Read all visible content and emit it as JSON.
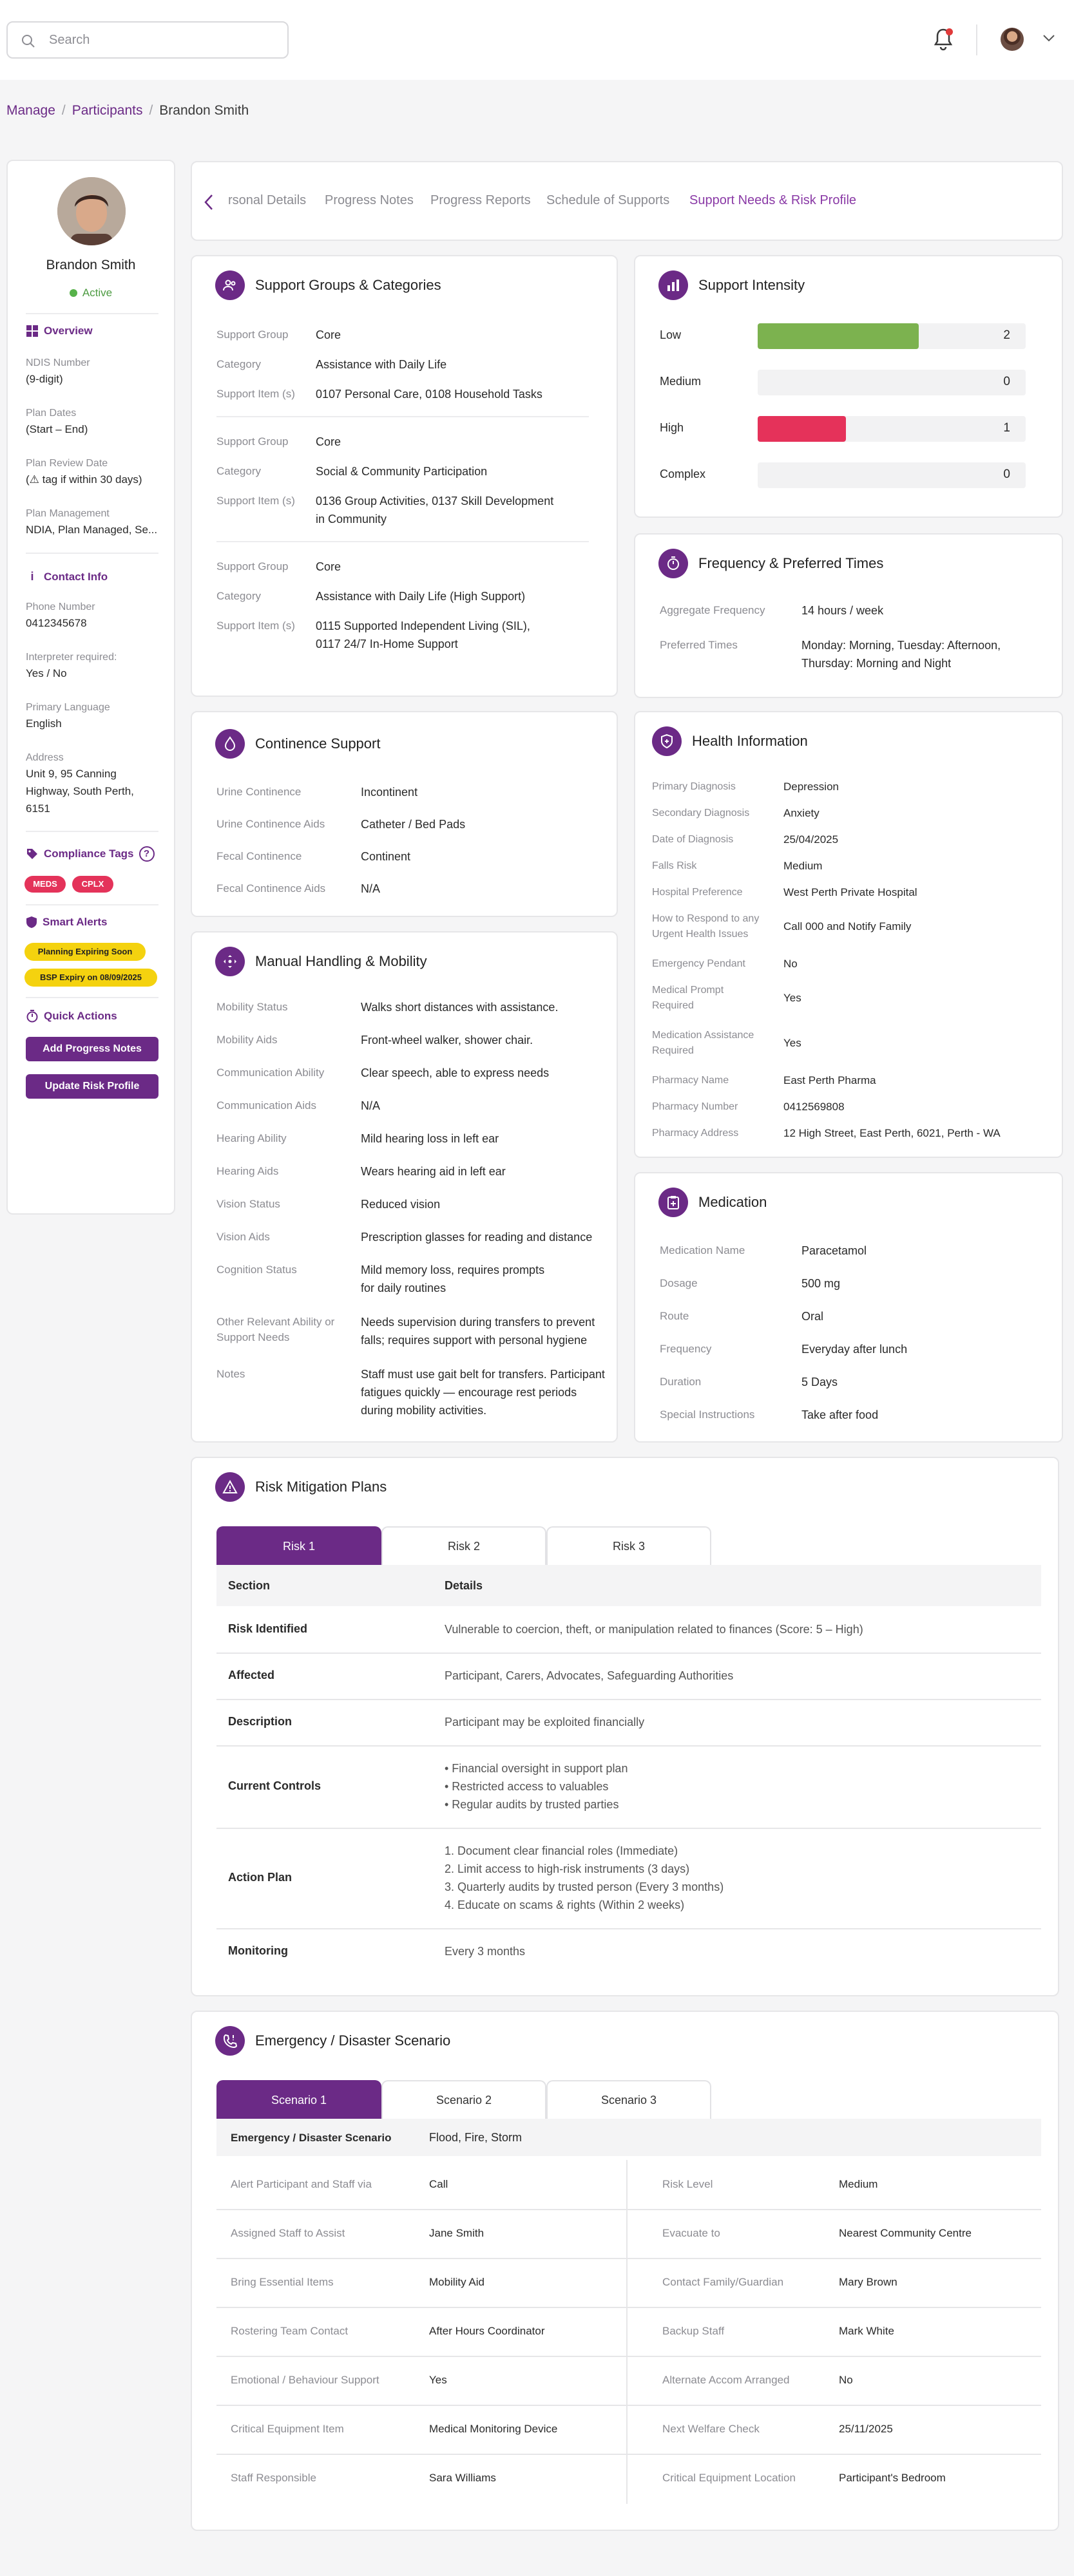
{
  "topbar": {
    "search_placeholder": "Search"
  },
  "breadcrumb": {
    "manage": "Manage",
    "participants": "Participants",
    "current": "Brandon Smith"
  },
  "sidebar": {
    "name": "Brandon Smith",
    "status": "Active",
    "overview_title": "Overview",
    "ndis_label": "NDIS Number",
    "ndis_value": "(9-digit)",
    "plan_dates_label": "Plan Dates",
    "plan_dates_value": "(Start – End)",
    "plan_review_label": "Plan Review Date",
    "plan_review_value": "(⚠ tag if within 30 days)",
    "plan_mgmt_label": "Plan Management",
    "plan_mgmt_value": "NDIA, Plan Managed, Se...",
    "contact_title": "Contact Info",
    "phone_label": "Phone Number",
    "phone_value": "0412345678",
    "interpreter_label": "Interpreter required:",
    "interpreter_value": "Yes / No",
    "language_label": "Primary Language",
    "language_value": "English",
    "address_label": "Address",
    "address_lines": [
      "Unit 9, 95 Canning",
      "Highway, South Perth,",
      "6151"
    ],
    "compliance_title": "Compliance Tags",
    "tags": [
      "MEDS",
      "CPLX"
    ],
    "alerts_title": "Smart Alerts",
    "alerts": [
      "Planning Expiring Soon",
      "BSP Expiry on 08/09/2025"
    ],
    "quick_title": "Quick Actions",
    "actions": [
      "Add Progress Notes",
      "Update Risk Profile"
    ]
  },
  "tabs": [
    "rsonal Details",
    "Progress Notes",
    "Progress Reports",
    "Schedule of Supports",
    "Support Needs & Risk Profile"
  ],
  "support_groups": {
    "title": "Support Groups & Categories",
    "label_group": "Support Group",
    "label_category": "Category",
    "label_item": "Support Item (s)",
    "groups": [
      {
        "group": "Core",
        "category": "Assistance with Daily Life",
        "items": [
          "0107 Personal Care, 0108 Household Tasks"
        ]
      },
      {
        "group": "Core",
        "category": "Social & Community Participation",
        "items": [
          "0136 Group Activities, 0137 Skill Development",
          "in Community"
        ]
      },
      {
        "group": "Core",
        "category": "Assistance with Daily Life (High Support)",
        "items": [
          "0115 Supported Independent Living (SIL),",
          "0117 24/7 In-Home Support"
        ]
      }
    ]
  },
  "support_intensity": {
    "title": "Support Intensity",
    "colors": {
      "low": "#7cb24f",
      "high": "#e5325a"
    },
    "rows": [
      {
        "label": "Low",
        "value": "2",
        "fill": 0.6
      },
      {
        "label": "Medium",
        "value": "0",
        "fill": 0
      },
      {
        "label": "High",
        "value": "1",
        "fill": 0.33
      },
      {
        "label": "Complex",
        "value": "0",
        "fill": 0
      }
    ]
  },
  "frequency": {
    "title": "Frequency & Preferred Times",
    "agg_label": "Aggregate Frequency",
    "agg_value": "14 hours / week",
    "pref_label": "Preferred Times",
    "pref_lines": [
      "Monday: Morning, Tuesday: Afternoon,",
      "Thursday: Morning and Night"
    ]
  },
  "continence": {
    "title": "Continence Support",
    "rows": [
      {
        "label": "Urine Continence",
        "value": "Incontinent"
      },
      {
        "label": "Urine Continence Aids",
        "value": "Catheter / Bed Pads"
      },
      {
        "label": "Fecal Continence",
        "value": "Continent"
      },
      {
        "label": "Fecal Continence Aids",
        "value": "N/A"
      }
    ]
  },
  "health": {
    "title": "Health Information",
    "rows": [
      {
        "label": [
          "Primary Diagnosis"
        ],
        "value": "Depression"
      },
      {
        "label": [
          "Secondary Diagnosis"
        ],
        "value": "Anxiety"
      },
      {
        "label": [
          "Date of Diagnosis"
        ],
        "value": "25/04/2025"
      },
      {
        "label": [
          "Falls Risk"
        ],
        "value": "Medium"
      },
      {
        "label": [
          "Hospital Preference"
        ],
        "value": "West Perth Private Hospital"
      },
      {
        "label": [
          "How to Respond to any",
          "Urgent Health Issues"
        ],
        "value": "Call 000 and Notify Family"
      },
      {
        "label": [
          "Emergency Pendant"
        ],
        "value": "No"
      },
      {
        "label": [
          "Medical Prompt",
          "Required"
        ],
        "value": "Yes"
      },
      {
        "label": [
          "Medication Assistance",
          "Required"
        ],
        "value": "Yes"
      },
      {
        "label": [
          "Pharmacy Name"
        ],
        "value": "East Perth Pharma"
      },
      {
        "label": [
          "Pharmacy Number"
        ],
        "value": "0412569808"
      },
      {
        "label": [
          "Pharmacy Address"
        ],
        "value": "12 High Street, East Perth, 6021, Perth - WA"
      }
    ]
  },
  "manual_handling": {
    "title": "Manual Handling & Mobility",
    "rows": [
      {
        "label": [
          "Mobility Status"
        ],
        "value": [
          "Walks short distances with assistance."
        ]
      },
      {
        "label": [
          "Mobility Aids"
        ],
        "value": [
          "Front-wheel walker, shower chair."
        ]
      },
      {
        "label": [
          "Communication Ability"
        ],
        "value": [
          "Clear speech, able to express needs"
        ]
      },
      {
        "label": [
          "Communication Aids"
        ],
        "value": [
          "N/A"
        ]
      },
      {
        "label": [
          "Hearing Ability"
        ],
        "value": [
          "Mild hearing loss in left ear"
        ]
      },
      {
        "label": [
          "Hearing Aids"
        ],
        "value": [
          "Wears hearing aid in left ear"
        ]
      },
      {
        "label": [
          "Vision Status"
        ],
        "value": [
          "Reduced vision"
        ]
      },
      {
        "label": [
          "Vision Aids"
        ],
        "value": [
          "Prescription glasses for reading and distance"
        ]
      },
      {
        "label": [
          "Cognition Status"
        ],
        "value": [
          "Mild memory loss, requires prompts",
          "for daily routines"
        ]
      },
      {
        "label": [
          "Other Relevant Ability or",
          "Support Needs"
        ],
        "value": [
          "Needs supervision during transfers to prevent",
          "falls; requires support with personal hygiene"
        ]
      },
      {
        "label": [
          "Notes"
        ],
        "value": [
          "Staff must use gait belt for transfers. Participant",
          "fatigues quickly — encourage rest periods",
          "during mobility activities."
        ]
      }
    ]
  },
  "medication": {
    "title": "Medication",
    "rows": [
      {
        "label": "Medication Name",
        "value": "Paracetamol"
      },
      {
        "label": "Dosage",
        "value": "500 mg"
      },
      {
        "label": "Route",
        "value": "Oral"
      },
      {
        "label": "Frequency",
        "value": "Everyday after lunch"
      },
      {
        "label": "Duration",
        "value": "5 Days"
      },
      {
        "label": "Special Instructions",
        "value": "Take after food"
      }
    ]
  },
  "risk": {
    "title": "Risk Mitigation Plans",
    "tabs": [
      "Risk 1",
      "Risk 2",
      "Risk 3"
    ],
    "col_section": "Section",
    "col_details": "Details",
    "rows": [
      {
        "section": "Risk Identified",
        "details": [
          "Vulnerable to coercion, theft, or manipulation related to finances (Score: 5 – High)"
        ]
      },
      {
        "section": "Affected",
        "details": [
          "Participant, Carers, Advocates, Safeguarding Authorities"
        ]
      },
      {
        "section": "Description",
        "details": [
          "Participant may be exploited financially"
        ]
      },
      {
        "section": "Current Controls",
        "details": [
          "• Financial oversight in support plan",
          "• Restricted access to valuables",
          "• Regular audits by trusted parties"
        ]
      },
      {
        "section": "Action Plan",
        "details": [
          "1. Document clear financial roles (Immediate)",
          "2. Limit access to high-risk instruments (3 days)",
          "3. Quarterly audits by trusted person (Every 3 months)",
          "4. Educate on scams & rights (Within 2 weeks)"
        ]
      },
      {
        "section": "Monitoring",
        "details": [
          "Every 3 months"
        ]
      }
    ]
  },
  "emergency": {
    "title": "Emergency / Disaster Scenario",
    "tabs": [
      "Scenario 1",
      "Scenario 2",
      "Scenario 3"
    ],
    "header_label": "Emergency / Disaster Scenario",
    "header_value": "Flood, Fire, Storm",
    "rows": [
      {
        "l1": "Alert Participant and Staff via",
        "v1": "Call",
        "l2": "Risk Level",
        "v2": "Medium"
      },
      {
        "l1": "Assigned Staff to Assist",
        "v1": "Jane Smith",
        "l2": "Evacuate to",
        "v2": "Nearest Community Centre"
      },
      {
        "l1": "Bring Essential Items",
        "v1": "Mobility Aid",
        "l2": "Contact Family/Guardian",
        "v2": "Mary Brown"
      },
      {
        "l1": "Rostering Team Contact",
        "v1": "After Hours Coordinator",
        "l2": "Backup Staff",
        "v2": "Mark White"
      },
      {
        "l1": "Emotional / Behaviour Support",
        "v1": "Yes",
        "l2": "Alternate Accom Arranged",
        "v2": "No"
      },
      {
        "l1": "Critical Equipment Item",
        "v1": "Medical Monitoring Device",
        "l2": "Next Welfare Check",
        "v2": "25/11/2025"
      },
      {
        "l1": "Staff Responsible",
        "v1": "Sara Williams",
        "l2": "Critical Equipment Location",
        "v2": "Participant's Bedroom"
      }
    ]
  }
}
